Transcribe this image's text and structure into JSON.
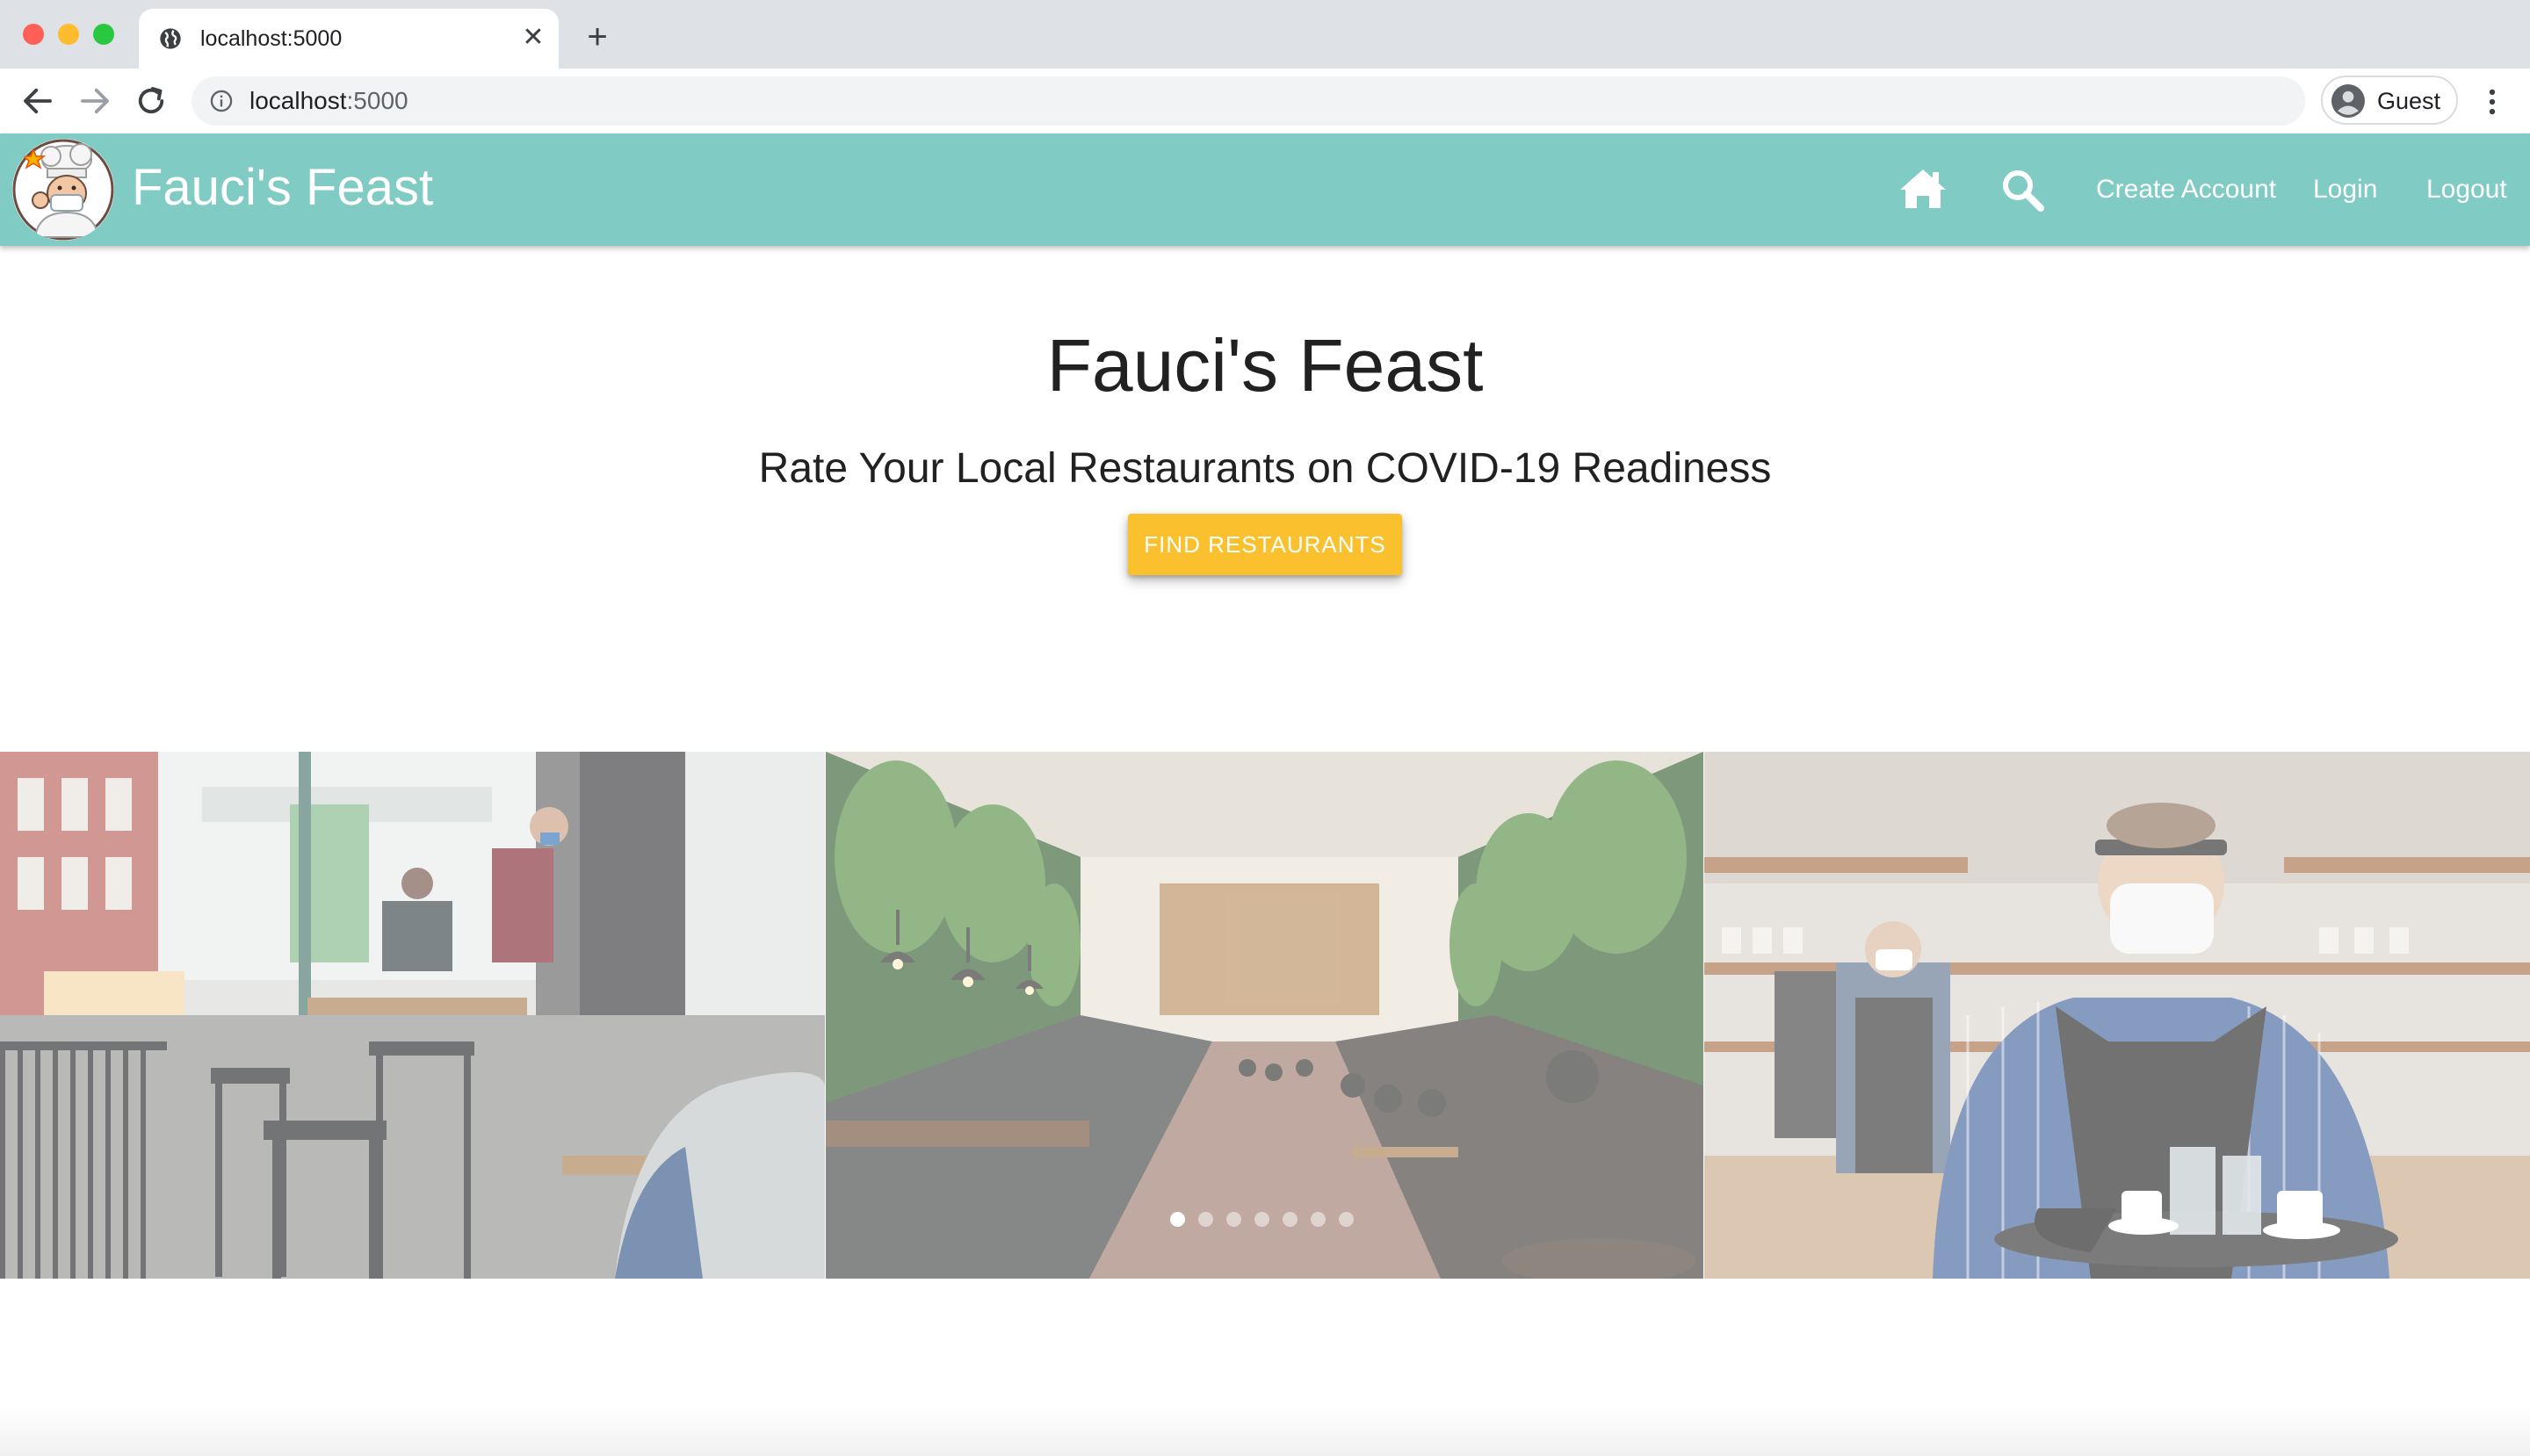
{
  "browser": {
    "tab_title": "localhost:5000",
    "tab_close": "✕",
    "new_tab": "+",
    "url_host": "localhost",
    "url_port": ":5000",
    "profile_name": "Guest"
  },
  "navbar": {
    "brand": "Fauci's Feast",
    "links": {
      "create_account": "Create Account",
      "login": "Login",
      "logout": "Logout"
    },
    "background": "#80cbc4"
  },
  "hero": {
    "title": "Fauci's Feast",
    "subtitle": "Rate Your Local Restaurants on COVID-19 Readiness",
    "cta_label": "FIND RESTAURANTS",
    "cta_color": "#fbc02d"
  },
  "carousel": {
    "slides": [
      "outdoor-patio-waiter-photo",
      "ivy-covered-food-hall-photo",
      "masked-waiter-with-tray-photo"
    ],
    "indicator_count": 7,
    "active_index": 0
  }
}
